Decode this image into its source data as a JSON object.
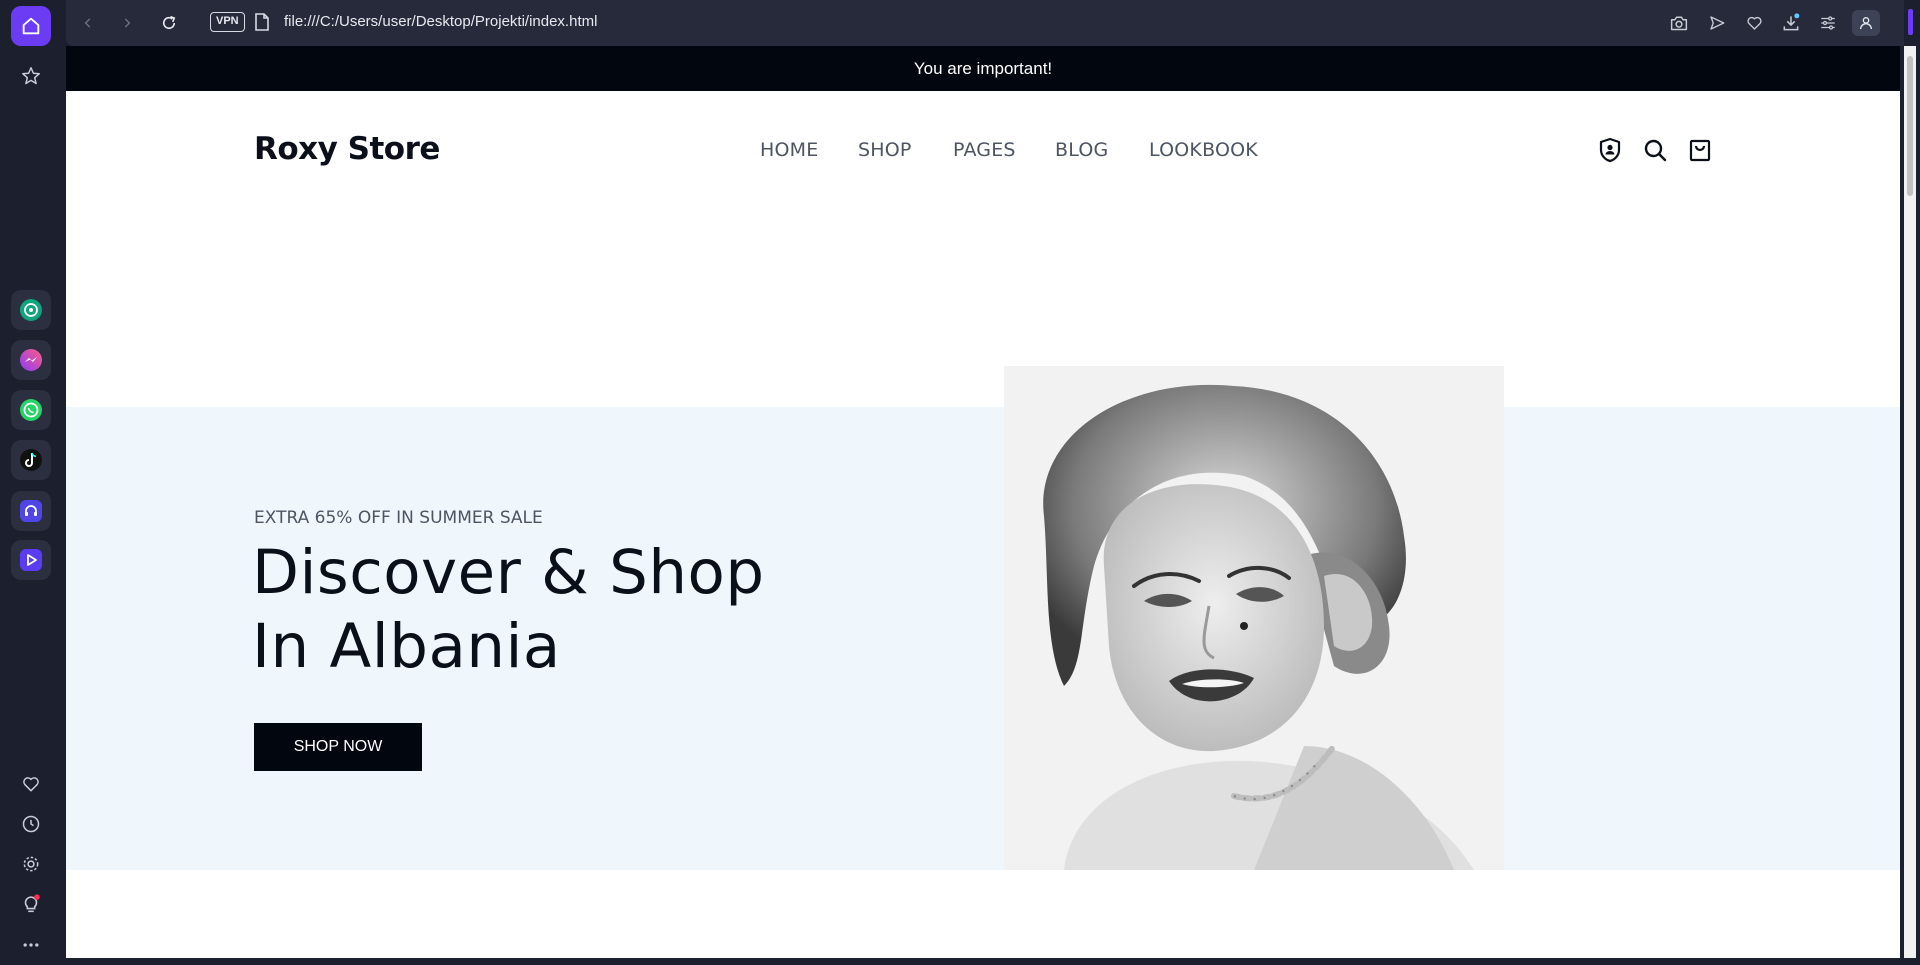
{
  "browser": {
    "vpn_label": "VPN",
    "url": "file:///C:/Users/user/Desktop/Projekti/index.html",
    "accent": "#6c3cf5",
    "sidebar_apps": [
      "chatgpt-icon",
      "messenger-icon",
      "whatsapp-icon",
      "tiktok-icon",
      "music-icon",
      "player-icon"
    ],
    "sidebar_bottom": [
      "heart-icon",
      "history-icon",
      "settings-icon",
      "lightbulb-icon",
      "more-icon"
    ]
  },
  "announcement": "You are important!",
  "header": {
    "logo": "Roxy Store",
    "nav": [
      "HOME",
      "SHOP",
      "PAGES",
      "BLOG",
      "LOOKBOOK"
    ],
    "icons": [
      "account-icon",
      "search-icon",
      "cart-icon"
    ]
  },
  "hero": {
    "eyebrow": "EXTRA 65% OFF IN SUMMER SALE",
    "title_line1": "Discover & Shop",
    "title_line2": "In Albania",
    "cta": "SHOP NOW",
    "background": "#f0f7fc"
  }
}
